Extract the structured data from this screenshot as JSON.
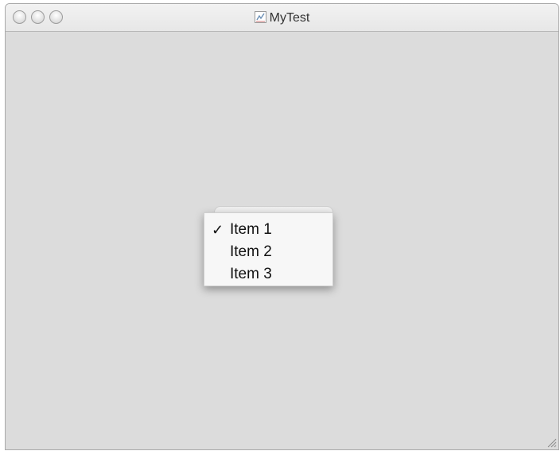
{
  "window": {
    "title": "MyTest",
    "app_icon": "java-app-icon"
  },
  "combo": {
    "selected": "Item 1",
    "options": [
      {
        "label": "Item 1",
        "checked": true,
        "check_glyph": "✓"
      },
      {
        "label": "Item 2",
        "checked": false,
        "check_glyph": ""
      },
      {
        "label": "Item 3",
        "checked": false,
        "check_glyph": ""
      }
    ]
  },
  "colors": {
    "window_bg": "#dcdcdc",
    "menu_bg": "#f7f7f7",
    "text": "#111111"
  }
}
